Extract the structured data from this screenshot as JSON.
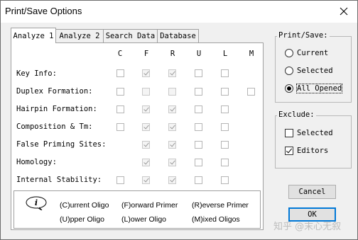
{
  "window": {
    "title": "Print/Save Options"
  },
  "tabs": [
    {
      "label": "Analyze 1",
      "active": true
    },
    {
      "label": "Analyze 2"
    },
    {
      "label": "Search Data"
    },
    {
      "label": "Database"
    }
  ],
  "columns": [
    "C",
    "F",
    "R",
    "U",
    "L",
    "M"
  ],
  "rows": [
    {
      "label": "Key Info:",
      "cells": [
        "unchecked",
        "checked",
        "checked",
        "unchecked",
        "unchecked",
        "none"
      ]
    },
    {
      "label": "Duplex Formation:",
      "cells": [
        "unchecked",
        "unchecked",
        "unchecked",
        "unchecked",
        "unchecked",
        "unchecked"
      ]
    },
    {
      "label": "Hairpin Formation:",
      "cells": [
        "unchecked",
        "checked",
        "checked",
        "unchecked",
        "unchecked",
        "none"
      ]
    },
    {
      "label": "Composition & Tm:",
      "cells": [
        "unchecked",
        "checked",
        "checked",
        "unchecked",
        "unchecked",
        "none"
      ]
    },
    {
      "label": "False Priming Sites:",
      "cells": [
        "none",
        "checked",
        "checked",
        "unchecked",
        "unchecked",
        "none"
      ]
    },
    {
      "label": "Homology:",
      "cells": [
        "none",
        "checked",
        "checked",
        "unchecked",
        "unchecked",
        "none"
      ]
    },
    {
      "label": "Internal Stability:",
      "cells": [
        "unchecked",
        "checked",
        "checked",
        "unchecked",
        "unchecked",
        "none"
      ]
    }
  ],
  "legend": {
    "info_icon_letter": "i",
    "c": "(C)urrent Oligo",
    "f": "(F)orward Primer",
    "r": "(R)everse Primer",
    "u": "(U)pper Oligo",
    "l": "(L)ower Oligo",
    "m": "(M)ixed Oligos"
  },
  "print_save": {
    "title": "Print/Save:",
    "options": [
      "Current",
      "Selected",
      "All Opened"
    ],
    "selected": "All Opened"
  },
  "exclude": {
    "title": "Exclude:",
    "options": [
      {
        "label": "Selected",
        "checked": false
      },
      {
        "label": "Editors",
        "checked": true
      }
    ]
  },
  "buttons": {
    "cancel": "Cancel",
    "ok": "OK"
  },
  "watermark": "知乎 @末心无叙"
}
